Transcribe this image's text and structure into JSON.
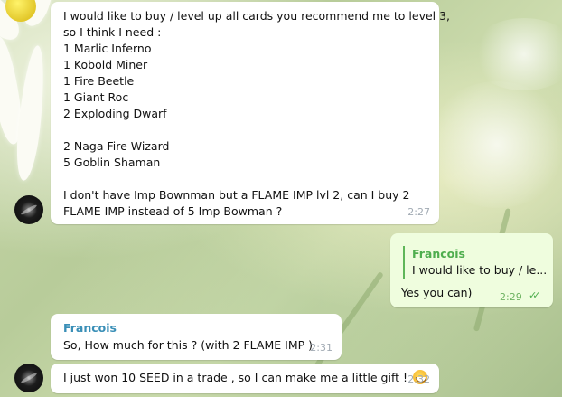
{
  "messages": {
    "m1": {
      "lines": [
        "I would like to buy / level up all cards you recommend me to level 3,",
        "so I think I need :",
        "1 Marlic Inferno",
        "1 Kobold Miner",
        "1 Fire Beetle",
        "1 Giant Roc",
        "2 Exploding Dwarf",
        "",
        "2 Naga Fire Wizard",
        "5 Goblin Shaman",
        "",
        "I don't have Imp Bownman but a FLAME IMP lvl 2, can I buy 2",
        "FLAME IMP instead of 5 Imp Bowman ?"
      ],
      "time": "2:27"
    },
    "m2": {
      "quote_name": "Francois",
      "quote_text": "I would like to buy / le...",
      "text": "Yes you can)",
      "time": "2:29",
      "status": "read"
    },
    "m3": {
      "sender": "Francois",
      "text": "So, How much for this ? (with 2 FLAME IMP )",
      "time": "2:31"
    },
    "m4": {
      "text": "I just won 10 SEED in a trade , so I can make me a little gift !",
      "emoji": "grinning-face",
      "time": "2:32"
    }
  },
  "colors": {
    "outgoing_bubble": "#effdde",
    "incoming_bubble": "#ffffff",
    "sender_name": "#3a8fb7",
    "quote_accent": "#5fb659"
  }
}
